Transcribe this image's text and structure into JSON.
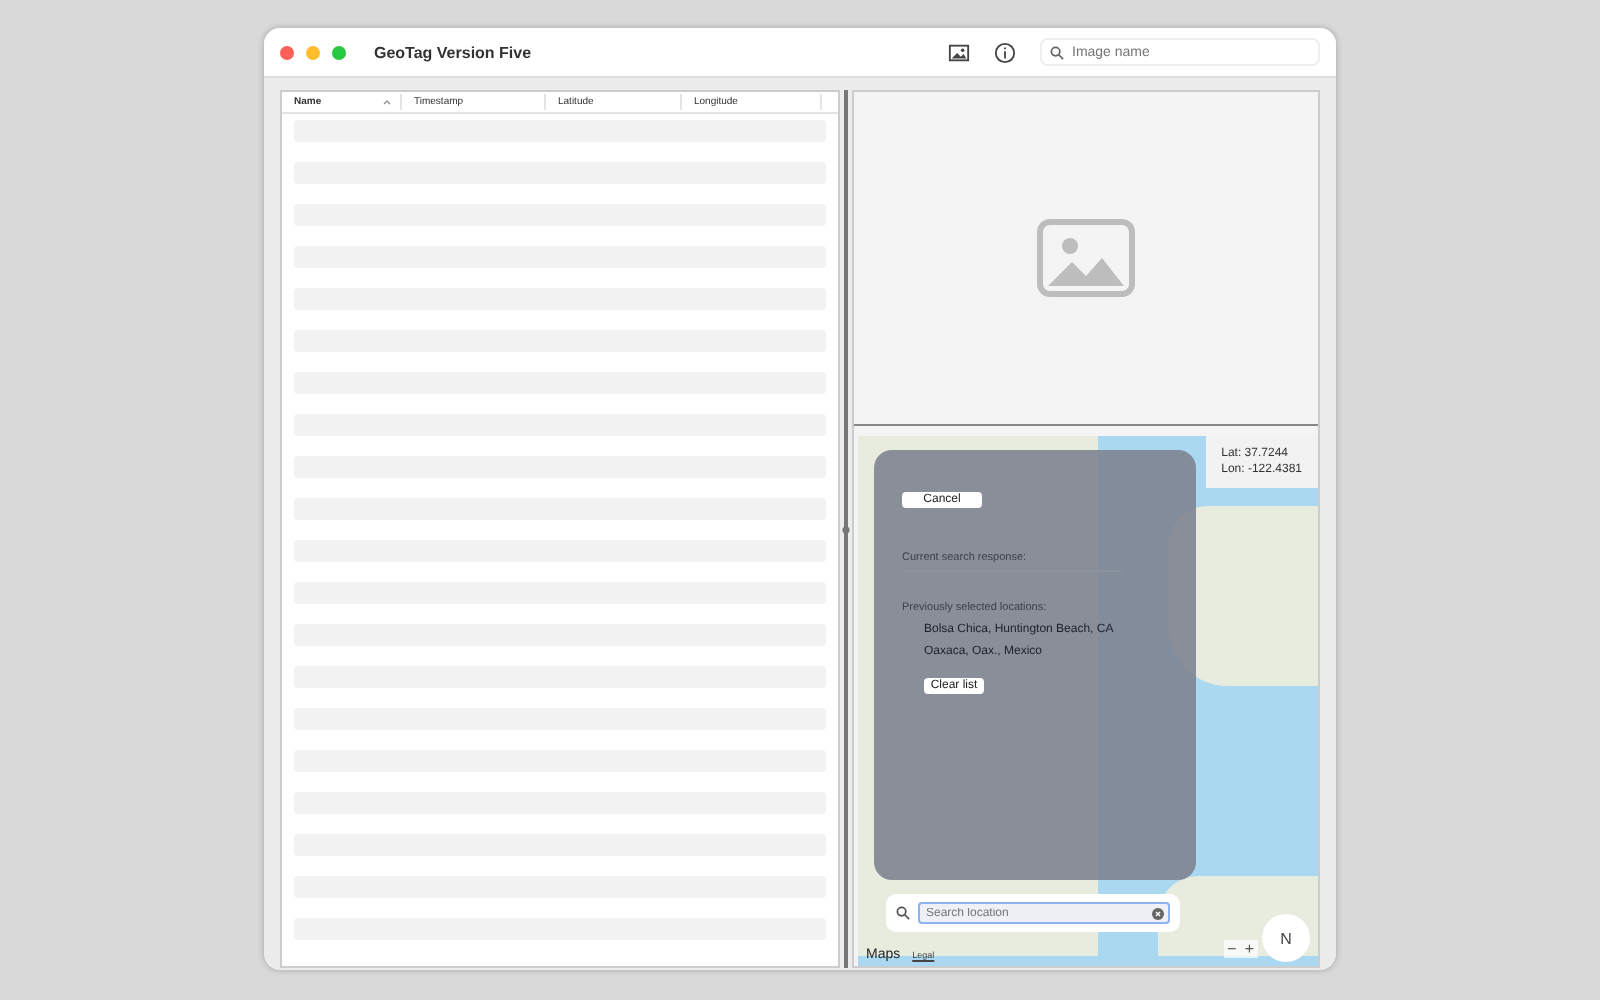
{
  "window": {
    "title": "GeoTag Version Five"
  },
  "toolbar": {
    "search": {
      "placeholder": "Image name"
    }
  },
  "table": {
    "columns": [
      {
        "label": "Name",
        "sorted": true
      },
      {
        "label": "Timestamp",
        "sorted": false
      },
      {
        "label": "Latitude",
        "sorted": false
      },
      {
        "label": "Longitude",
        "sorted": false
      }
    ]
  },
  "map": {
    "coordinates": {
      "lat": "Lat: 37.7244",
      "lon": "Lon: -122.4381"
    },
    "search_panel": {
      "cancel": "Cancel",
      "current_label": "Current search response:",
      "previous_label": "Previously selected locations:",
      "locations": [
        "Bolsa Chica, Huntington Beach, CA",
        "Oaxaca, Oax., Mexico"
      ],
      "clear": "Clear list"
    },
    "search_field": {
      "placeholder": "Search location"
    },
    "attribution": {
      "logo": "Maps",
      "legal": "Legal"
    },
    "zoom_controls": {
      "zoom_out": "−",
      "zoom_in": "+"
    },
    "compass": "N"
  }
}
